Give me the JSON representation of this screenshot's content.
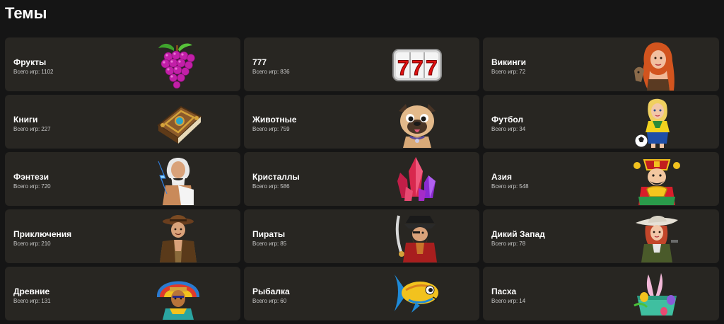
{
  "page": {
    "title": "Темы",
    "count_label": "Всего игр:"
  },
  "themes": [
    {
      "name": "Фрукты",
      "count": "1102",
      "icon": "grapes-icon"
    },
    {
      "name": "777",
      "count": "836",
      "icon": "slot-777-icon"
    },
    {
      "name": "Викинги",
      "count": "72",
      "icon": "viking-woman-icon"
    },
    {
      "name": "Книги",
      "count": "227",
      "icon": "book-icon"
    },
    {
      "name": "Животные",
      "count": "759",
      "icon": "pug-dog-icon"
    },
    {
      "name": "Футбол",
      "count": "34",
      "icon": "football-girl-icon"
    },
    {
      "name": "Фэнтези",
      "count": "720",
      "icon": "zeus-icon"
    },
    {
      "name": "Кристаллы",
      "count": "586",
      "icon": "crystals-icon"
    },
    {
      "name": "Азия",
      "count": "548",
      "icon": "asian-fortune-god-icon"
    },
    {
      "name": "Приключения",
      "count": "210",
      "icon": "adventurer-icon"
    },
    {
      "name": "Пираты",
      "count": "85",
      "icon": "pirate-icon"
    },
    {
      "name": "Дикий Запад",
      "count": "78",
      "icon": "cowgirl-icon"
    },
    {
      "name": "Древние",
      "count": "131",
      "icon": "aztec-warrior-icon"
    },
    {
      "name": "Рыбалка",
      "count": "60",
      "icon": "fish-icon"
    },
    {
      "name": "Пасха",
      "count": "14",
      "icon": "easter-basket-icon"
    }
  ]
}
